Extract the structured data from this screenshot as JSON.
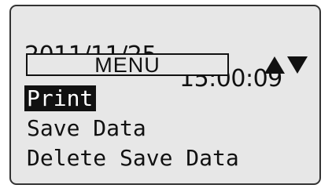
{
  "status_bar": {
    "date": "2011/11/25",
    "time": "15:00:09"
  },
  "menu": {
    "title": "MENU",
    "scroll_up_icon": "up-triangle",
    "scroll_down_icon": "down-triangle",
    "items": [
      {
        "label": "Print",
        "selected": true
      },
      {
        "label": "Save Data",
        "selected": false
      },
      {
        "label": "Delete Save Data",
        "selected": false
      }
    ]
  },
  "colors": {
    "lcd_background": "#e7e7e7",
    "text": "#111111",
    "selection_background": "#111111",
    "selection_text": "#ffffff"
  }
}
